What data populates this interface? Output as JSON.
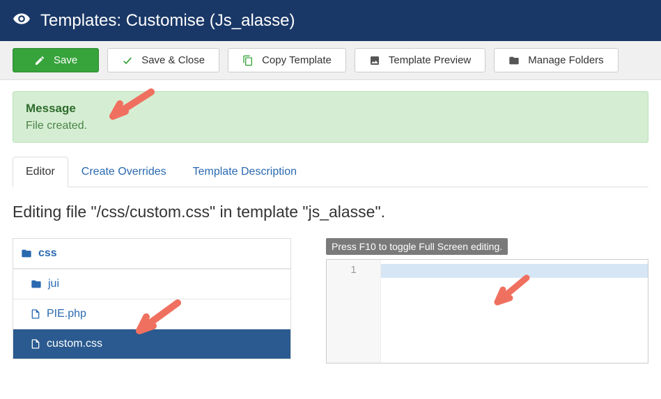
{
  "header": {
    "title": "Templates: Customise (Js_alasse)"
  },
  "toolbar": {
    "save": "Save",
    "saveClose": "Save & Close",
    "copy": "Copy Template",
    "preview": "Template Preview",
    "manage": "Manage Folders"
  },
  "alert": {
    "title": "Message",
    "text": "File created."
  },
  "tabs": {
    "editor": "Editor",
    "overrides": "Create Overrides",
    "description": "Template Description"
  },
  "editing": "Editing file \"/css/custom.css\" in template \"js_alasse\".",
  "tree": {
    "root": "css",
    "items": [
      {
        "type": "folder",
        "label": "jui"
      },
      {
        "type": "file",
        "label": "PIE.php"
      },
      {
        "type": "file",
        "label": "custom.css",
        "active": true
      }
    ]
  },
  "editor": {
    "hint": "Press F10 to toggle Full Screen editing.",
    "lineNumber": "1"
  }
}
